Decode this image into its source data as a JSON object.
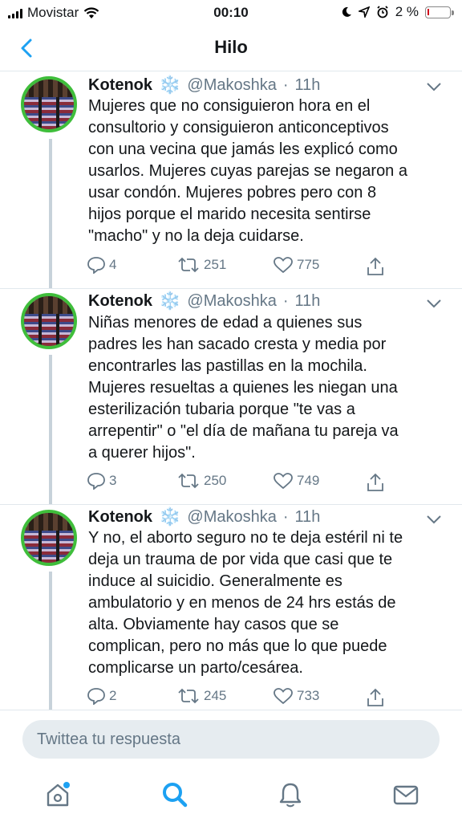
{
  "status_bar": {
    "carrier": "Movistar",
    "time": "00:10",
    "battery": "2 %"
  },
  "nav": {
    "title": "Hilo"
  },
  "tweets": [
    {
      "name": "Kotenok",
      "badge": "❄️",
      "handle": "@Makoshka",
      "separator": "·",
      "time": "11h",
      "text": "Mujeres que no consiguieron hora en el\nconsultorio y consiguieron anticonceptivos\ncon una vecina que jamás les explicó como\nusarlos. Mujeres cuyas parejas se negaron a\nusar condón. Mujeres pobres pero con 8\nhijos porque el marido necesita sentirse\n\"macho\" y no la deja cuidarse.",
      "replies": "4",
      "retweets": "251",
      "likes": "775"
    },
    {
      "name": "Kotenok",
      "badge": "❄️",
      "handle": "@Makoshka",
      "separator": "·",
      "time": "11h",
      "text": "Niñas menores de edad a quienes sus\npadres les han sacado cresta y media por\nencontrarles las pastillas en la mochila.\nMujeres resueltas a quienes les niegan una\nesterilización tubaria porque \"te vas a\narrepentir\" o \"el día de mañana tu pareja va\na querer hijos\".",
      "replies": "3",
      "retweets": "250",
      "likes": "749"
    },
    {
      "name": "Kotenok",
      "badge": "❄️",
      "handle": "@Makoshka",
      "separator": "·",
      "time": "11h",
      "text": "Y no, el aborto seguro no te deja estéril ni te\ndeja un trauma de por vida que casi que te\ninduce al suicidio. Generalmente es\nambulatorio y en menos de 24 hrs estás de\nalta. Obviamente hay casos que se\ncomplican, pero no más que lo que puede\ncomplicarse un parto/cesárea.",
      "replies": "2",
      "retweets": "245",
      "likes": "733"
    }
  ],
  "reply": {
    "placeholder": "Twittea tu respuesta"
  },
  "tabs": [
    "home-icon",
    "search-icon",
    "notifications-icon",
    "messages-icon"
  ],
  "colors": {
    "accent": "#1da1f2",
    "text": "#14171a",
    "muted": "#657786",
    "avatar_ring": "#3fbe3b"
  }
}
